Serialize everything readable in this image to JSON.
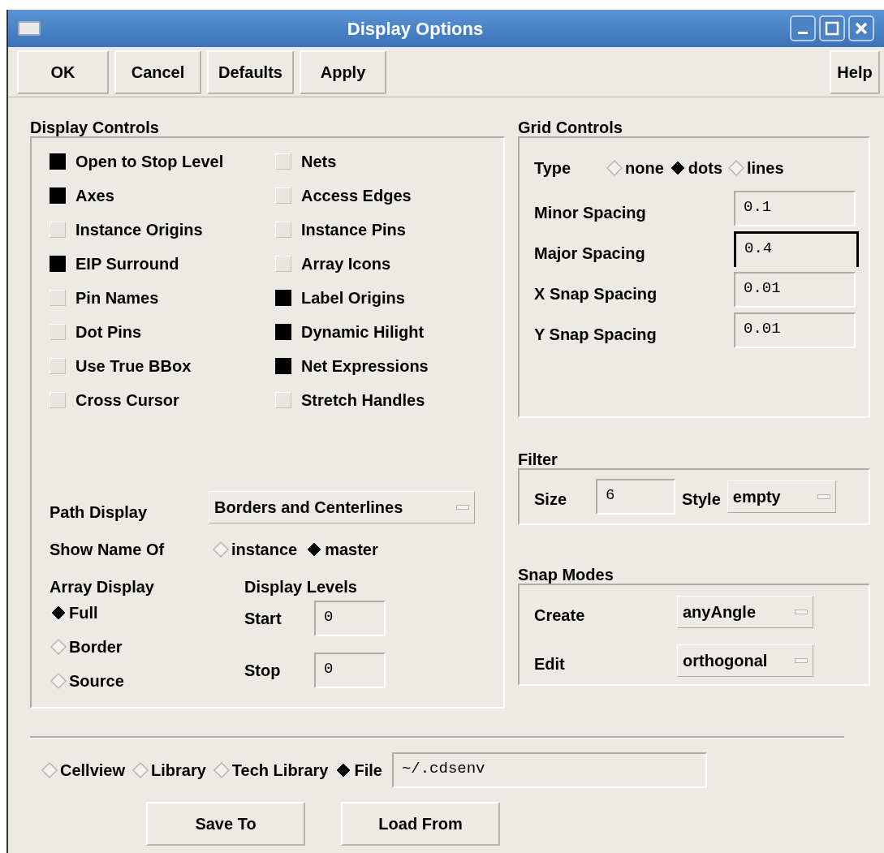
{
  "window": {
    "title": "Display Options"
  },
  "toolbar": [
    {
      "label": "OK"
    },
    {
      "label": "Cancel"
    },
    {
      "label": "Defaults"
    },
    {
      "label": "Apply"
    }
  ],
  "help_button": {
    "label": "Help"
  },
  "display_controls": {
    "title": "Display Controls",
    "columns": [
      [
        {
          "label": "Open to Stop Level",
          "checked": true
        },
        {
          "label": "Axes",
          "checked": true
        },
        {
          "label": "Instance Origins",
          "checked": false
        },
        {
          "label": "EIP Surround",
          "checked": true
        },
        {
          "label": "Pin Names",
          "checked": false
        },
        {
          "label": "Dot Pins",
          "checked": false
        },
        {
          "label": "Use True BBox",
          "checked": false
        },
        {
          "label": "Cross Cursor",
          "checked": false
        }
      ],
      [
        {
          "label": "Nets",
          "checked": false
        },
        {
          "label": "Access Edges",
          "checked": false
        },
        {
          "label": "Instance Pins",
          "checked": false
        },
        {
          "label": "Array Icons",
          "checked": false
        },
        {
          "label": "Label Origins",
          "checked": true
        },
        {
          "label": "Dynamic Hilight",
          "checked": true
        },
        {
          "label": "Net Expressions",
          "checked": true
        },
        {
          "label": "Stretch Handles",
          "checked": false
        }
      ]
    ],
    "path_display": {
      "label": "Path Display",
      "value": "Borders and Centerlines"
    },
    "show_name_of": {
      "label": "Show Name Of",
      "options": [
        {
          "label": "instance",
          "selected": false
        },
        {
          "label": "master",
          "selected": true
        }
      ]
    },
    "array_display": {
      "label": "Array Display",
      "options": [
        {
          "label": "Full",
          "selected": true
        },
        {
          "label": "Border",
          "selected": false
        },
        {
          "label": "Source",
          "selected": false
        }
      ]
    },
    "display_levels": {
      "label": "Display Levels",
      "fields": [
        {
          "label": "Start",
          "value": "0"
        },
        {
          "label": "Stop",
          "value": "0"
        }
      ]
    }
  },
  "grid_controls": {
    "title": "Grid Controls",
    "type": {
      "label": "Type",
      "options": [
        {
          "label": "none",
          "selected": false
        },
        {
          "label": "dots",
          "selected": true
        },
        {
          "label": "lines",
          "selected": false
        }
      ]
    },
    "fields": [
      {
        "label": "Minor Spacing",
        "value": "0.1",
        "focused": false
      },
      {
        "label": "Major Spacing",
        "value": "0.4",
        "focused": true
      },
      {
        "label": "X Snap Spacing",
        "value": "0.01",
        "focused": false
      },
      {
        "label": "Y Snap Spacing",
        "value": "0.01",
        "focused": false
      }
    ]
  },
  "filter": {
    "title": "Filter",
    "size": {
      "label": "Size",
      "value": "6"
    },
    "style": {
      "label": "Style",
      "value": "empty"
    }
  },
  "snap_modes": {
    "title": "Snap Modes",
    "fields": [
      {
        "label": "Create",
        "value": "anyAngle"
      },
      {
        "label": "Edit",
        "value": "orthogonal"
      }
    ]
  },
  "save_location": {
    "options": [
      {
        "label": "Cellview",
        "selected": false
      },
      {
        "label": "Library",
        "selected": false
      },
      {
        "label": "Tech Library",
        "selected": false
      },
      {
        "label": "File",
        "selected": true
      }
    ],
    "file_value": "~/.cdsenv"
  },
  "bottom_buttons": [
    {
      "label": "Save To"
    },
    {
      "label": "Load From"
    }
  ]
}
